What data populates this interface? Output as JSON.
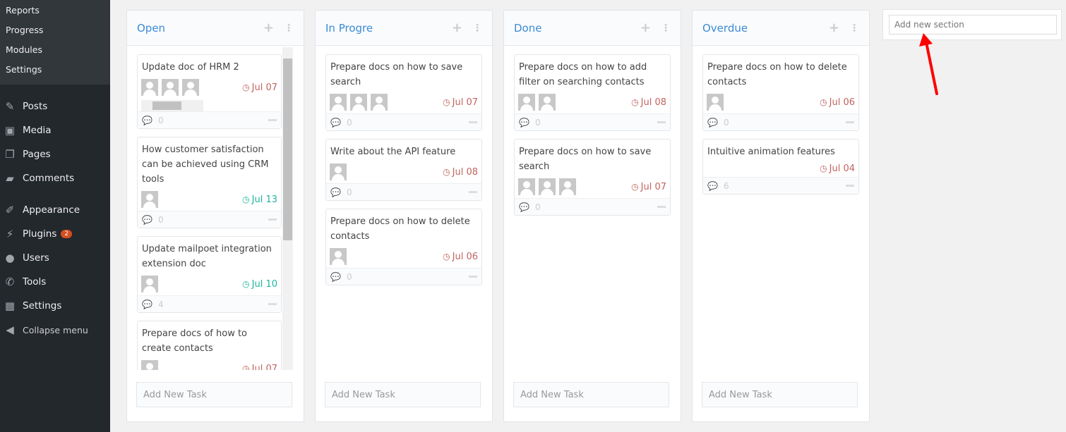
{
  "sidebar": {
    "submenu": [
      "Reports",
      "Progress",
      "Modules",
      "Settings"
    ],
    "menu": [
      {
        "label": "Posts",
        "icon": "pin-icon",
        "glyph": "✎"
      },
      {
        "label": "Media",
        "icon": "media-icon",
        "glyph": "▣"
      },
      {
        "label": "Pages",
        "icon": "pages-icon",
        "glyph": "❐"
      },
      {
        "label": "Comments",
        "icon": "comment-icon",
        "glyph": "▰"
      },
      {
        "gap": true
      },
      {
        "label": "Appearance",
        "icon": "brush-icon",
        "glyph": "✐"
      },
      {
        "label": "Plugins",
        "icon": "plugin-icon",
        "glyph": "⚡",
        "badge": "2"
      },
      {
        "label": "Users",
        "icon": "user-icon",
        "glyph": "●"
      },
      {
        "label": "Tools",
        "icon": "wrench-icon",
        "glyph": "✆"
      },
      {
        "label": "Settings",
        "icon": "settings-icon",
        "glyph": "▦"
      },
      {
        "label": "Collapse menu",
        "icon": "collapse-icon",
        "glyph": "◀",
        "collapse": true
      }
    ]
  },
  "colors": {
    "overdue": "#c0645f",
    "upcoming": "#1fb59e",
    "title": "#3b8bd6"
  },
  "columns": [
    {
      "title": "Open",
      "add_task": "Add New Task",
      "scroll": true,
      "cards": [
        {
          "title": "Update doc of HRM 2",
          "avatars": 3,
          "hscroll": true,
          "due": "Jul 07",
          "status": "overdue",
          "comments": "0"
        },
        {
          "title": "How customer satisfaction can be achieved using CRM tools",
          "avatars": 1,
          "due": "Jul 13",
          "status": "upcoming",
          "comments": "0"
        },
        {
          "title": "Update mailpoet integration extension doc",
          "avatars": 1,
          "due": "Jul 10",
          "status": "upcoming",
          "comments": "4"
        },
        {
          "title": "Prepare docs of how to create contacts",
          "avatars": 1,
          "due": "Jul 07",
          "status": "overdue",
          "comments": ""
        }
      ]
    },
    {
      "title": "In Progre",
      "add_task": "Add New Task",
      "cards": [
        {
          "title": "Prepare docs on how to save search",
          "avatars": 3,
          "due": "Jul 07",
          "status": "overdue",
          "comments": "0"
        },
        {
          "title": "Write about the API feature",
          "avatars": 1,
          "due": "Jul 08",
          "status": "overdue",
          "comments": "0"
        },
        {
          "title": "Prepare docs on how to delete contacts",
          "avatars": 1,
          "due": "Jul 06",
          "status": "overdue",
          "comments": "0"
        }
      ]
    },
    {
      "title": "Done",
      "add_task": "Add New Task",
      "cards": [
        {
          "title": "Prepare docs on how to add filter on searching contacts",
          "avatars": 2,
          "due": "Jul 08",
          "status": "overdue",
          "comments": "0"
        },
        {
          "title": "Prepare docs on how to save search",
          "avatars": 3,
          "due": "Jul 07",
          "status": "overdue",
          "comments": "0"
        }
      ]
    },
    {
      "title": "Overdue",
      "add_task": "Add New Task",
      "cards": [
        {
          "title": "Prepare docs on how to delete contacts",
          "avatars": 1,
          "due": "Jul 06",
          "status": "overdue",
          "comments": "0"
        },
        {
          "title": "Intuitive animation features",
          "avatars": 0,
          "due": "Jul 04",
          "status": "overdue",
          "comments": "6"
        }
      ]
    }
  ],
  "new_section": {
    "placeholder": "Add new section"
  }
}
